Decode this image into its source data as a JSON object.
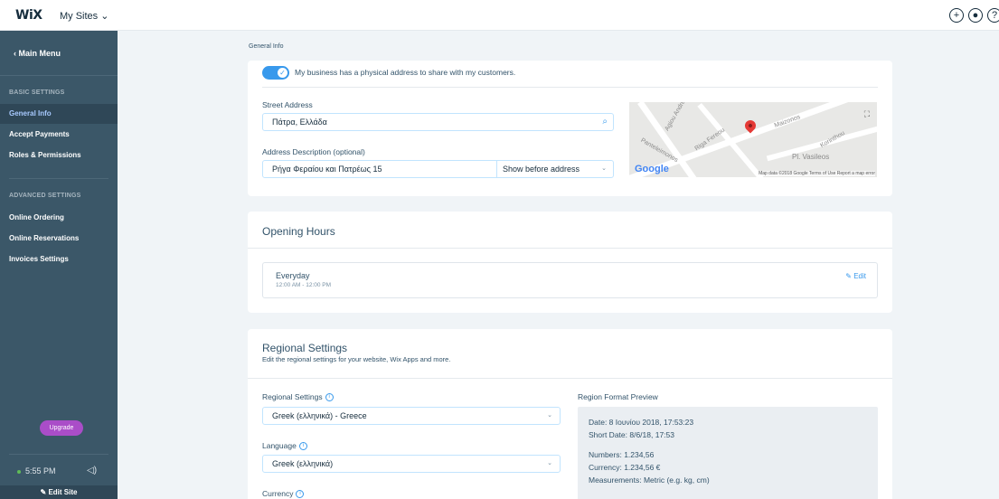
{
  "topbar": {
    "logo": "WiX",
    "my_sites": "My Sites ⌄",
    "icons": [
      "plus-icon",
      "notifications-icon",
      "help-icon"
    ]
  },
  "sidebar": {
    "main_menu": "‹  Main Menu",
    "basic_settings_title": "BASIC SETTINGS",
    "basic_items": [
      "General Info",
      "Accept Payments",
      "Roles & Permissions"
    ],
    "advanced_settings_title": "ADVANCED SETTINGS",
    "advanced_items": [
      "Online Ordering",
      "Online Reservations",
      "Invoices Settings"
    ],
    "upgrade_label": "Upgrade",
    "time": "5:55 PM",
    "edit_site": "Edit Site"
  },
  "breadcrumb": "General Info",
  "address_card": {
    "toggle_label": "My business has a physical address to share with my customers.",
    "street_label": "Street Address",
    "street_value": "Πάτρα, Ελλάδα",
    "desc_label": "Address Description (optional)",
    "desc_value": "Ρήγα Φεραίου και Πατρέως 15",
    "show_option": "Show before address",
    "map": {
      "google": "Google",
      "streets": [
        "Agiou Andreou",
        "Maizonos",
        "Riga Fereou",
        "Pl. Vasileos",
        "Korinthou",
        "Panteleimonos"
      ],
      "footer": "Map data ©2018 Google   Terms of Use   Report a map error"
    }
  },
  "opening_hours": {
    "title": "Opening Hours",
    "day": "Everyday",
    "hours": "12:00 AM - 12:00 PM",
    "edit": "Edit"
  },
  "regional": {
    "title": "Regional Settings",
    "subtitle": "Edit the regional settings for your website, Wix Apps and more.",
    "settings_label": "Regional Settings",
    "settings_value": "Greek (ελληνικά) - Greece",
    "language_label": "Language",
    "language_value": "Greek (ελληνικά)",
    "currency_label": "Currency",
    "preview_label": "Region Format Preview",
    "preview": {
      "date": "Date: 8 Ιουνίου 2018, 17:53:23",
      "short_date": "Short Date: 8/6/18, 17:53",
      "numbers": "Numbers: 1.234,56",
      "currency": "Currency: 1.234,56 €",
      "measurements": "Measurements: Metric (e.g. kg, cm)"
    }
  },
  "colors": {
    "accent": "#3899ec",
    "sidebar": "#3b5768",
    "upgrade": "#aa4dc8"
  }
}
